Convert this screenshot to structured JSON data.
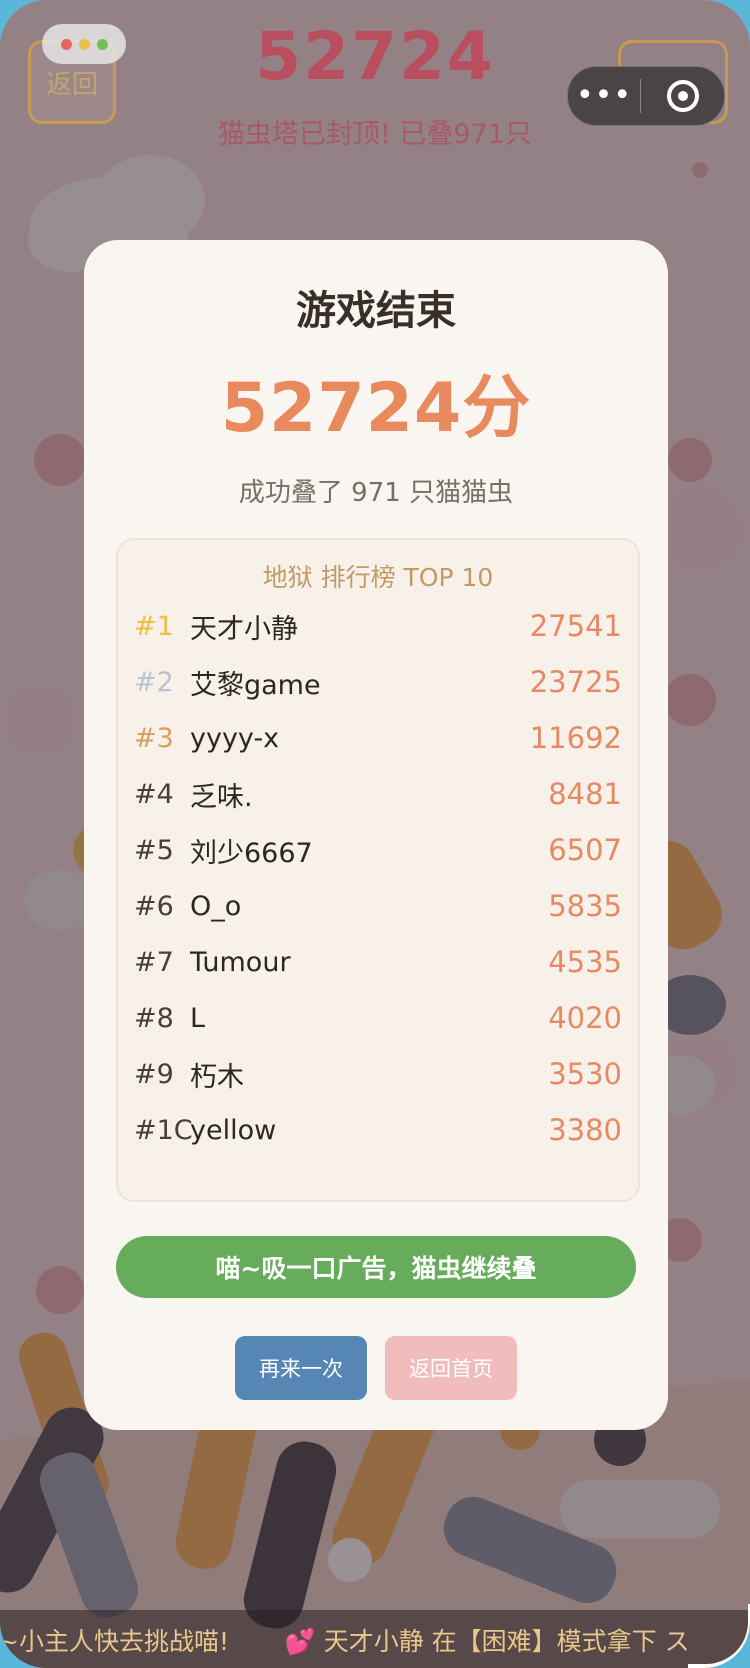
{
  "hud": {
    "back_label": "返回",
    "score": "52724",
    "status": "猫虫塔已封顶! 已叠971只",
    "right_label": "52724"
  },
  "modal": {
    "title": "游戏结束",
    "score": "52724分",
    "desc": "成功叠了 971 只猫猫虫",
    "board_title": "地狱 排行榜 TOP 10",
    "leaderboard": [
      {
        "rank": "#1",
        "name": "天才小静",
        "score": "27541",
        "rank_color": "#f2be3f"
      },
      {
        "rank": "#2",
        "name": "艾黎game",
        "score": "23725",
        "rank_color": "#b9c3d0"
      },
      {
        "rank": "#3",
        "name": "yyyy-x",
        "score": "11692",
        "rank_color": "#d9a05a"
      },
      {
        "rank": "#4",
        "name": "乏味.",
        "score": "8481",
        "rank_color": "#4a3e38"
      },
      {
        "rank": "#5",
        "name": "刘少6667",
        "score": "6507",
        "rank_color": "#4a3e38"
      },
      {
        "rank": "#6",
        "name": "O_o",
        "score": "5835",
        "rank_color": "#4a3e38"
      },
      {
        "rank": "#7",
        "name": "Tumour",
        "score": "4535",
        "rank_color": "#4a3e38"
      },
      {
        "rank": "#8",
        "name": "L",
        "score": "4020",
        "rank_color": "#4a3e38"
      },
      {
        "rank": "#9",
        "name": "朽木",
        "score": "3530",
        "rank_color": "#4a3e38"
      },
      {
        "rank": "#1C",
        "name": "yellow",
        "score": "3380",
        "rank_color": "#4a3e38"
      }
    ],
    "ad_button": "喵~吸一口广告，猫虫继续叠",
    "again_button": "再来一次",
    "home_button": "返回首页"
  },
  "capsule": {
    "more_icon": "more-dots-icon",
    "close_icon": "target-close-icon"
  },
  "marquee": {
    "text_a": "~小主人快去挑战喵!",
    "heart": "💕",
    "text_b": "天才小静 在【困难】模式拿下 ス"
  },
  "colors": {
    "accent": "#e88a5e",
    "green": "#66ac5b",
    "blue": "#5686b3",
    "pink": "#f1bcbc"
  }
}
